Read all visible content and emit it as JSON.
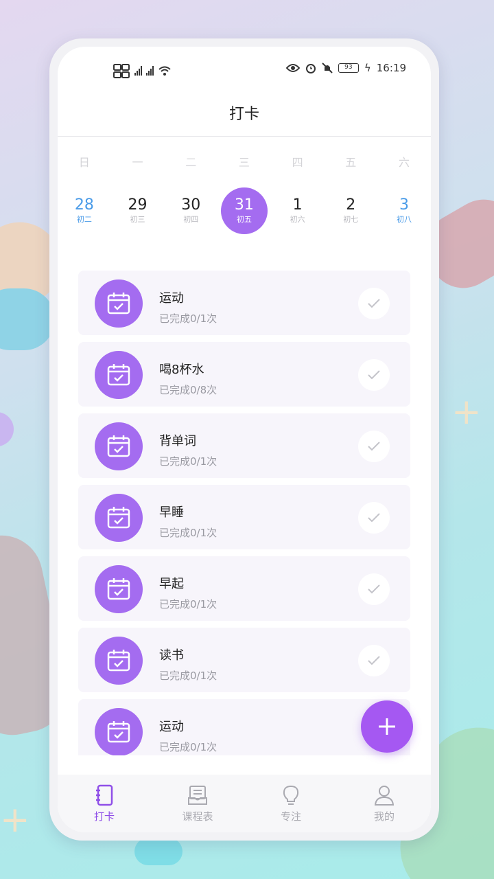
{
  "status_bar": {
    "time": "16:19",
    "battery": "93"
  },
  "header": {
    "title": "打卡"
  },
  "calendar": {
    "weekdays": [
      "日",
      "一",
      "二",
      "三",
      "四",
      "五",
      "六"
    ],
    "dates": [
      {
        "day": "28",
        "lunar": "初二"
      },
      {
        "day": "29",
        "lunar": "初三"
      },
      {
        "day": "30",
        "lunar": "初四"
      },
      {
        "day": "31",
        "lunar": "初五"
      },
      {
        "day": "1",
        "lunar": "初六"
      },
      {
        "day": "2",
        "lunar": "初七"
      },
      {
        "day": "3",
        "lunar": "初八"
      }
    ]
  },
  "habits": [
    {
      "name": "运动",
      "progress": "已完成0/1次"
    },
    {
      "name": "喝8杯水",
      "progress": "已完成0/8次"
    },
    {
      "name": "背单词",
      "progress": "已完成0/1次"
    },
    {
      "name": "早睡",
      "progress": "已完成0/1次"
    },
    {
      "name": "早起",
      "progress": "已完成0/1次"
    },
    {
      "name": "读书",
      "progress": "已完成0/1次"
    },
    {
      "name": "运动",
      "progress": "已完成0/1次"
    }
  ],
  "nav": [
    {
      "label": "打卡",
      "icon": "notebook-icon"
    },
    {
      "label": "课程表",
      "icon": "schedule-icon"
    },
    {
      "label": "专注",
      "icon": "bulb-icon"
    },
    {
      "label": "我的",
      "icon": "user-icon"
    }
  ],
  "colors": {
    "accent": "#a46cf0",
    "weekend": "#4a9be8",
    "fab": "#a558f2"
  }
}
